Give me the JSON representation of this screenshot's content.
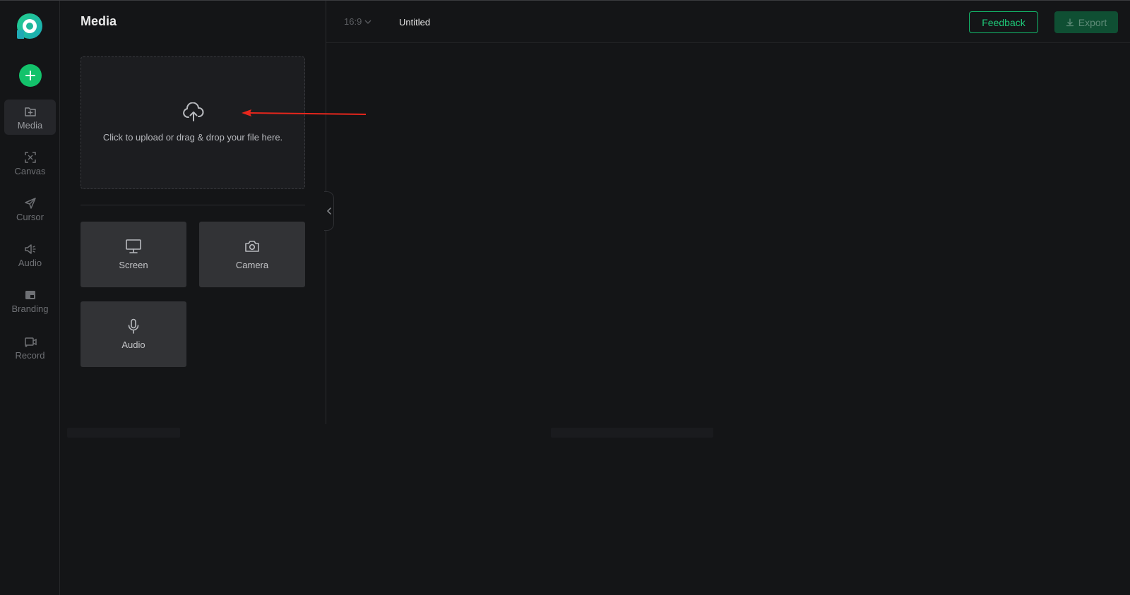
{
  "panel": {
    "title": "Media"
  },
  "upload": {
    "text": "Click to upload or drag & drop your file here."
  },
  "sidebar": {
    "items": [
      {
        "label": "Media",
        "icon": "folder-icon",
        "active": true
      },
      {
        "label": "Canvas",
        "icon": "canvas-icon"
      },
      {
        "label": "Cursor",
        "icon": "cursor-icon"
      },
      {
        "label": "Audio",
        "icon": "speaker-icon"
      },
      {
        "label": "Branding",
        "icon": "branding-icon"
      },
      {
        "label": "Record",
        "icon": "record-icon"
      }
    ]
  },
  "sources": [
    {
      "label": "Screen",
      "icon": "monitor-icon"
    },
    {
      "label": "Camera",
      "icon": "camera-icon"
    },
    {
      "label": "Audio",
      "icon": "microphone-icon"
    }
  ],
  "topbar": {
    "aspect_ratio": "16:9",
    "doc_title": "Untitled",
    "feedback_label": "Feedback",
    "export_label": "Export"
  },
  "colors": {
    "accent": "#13c26b",
    "background": "#141517",
    "panel_tile": "#323336",
    "annotation_arrow": "#e8261c"
  }
}
